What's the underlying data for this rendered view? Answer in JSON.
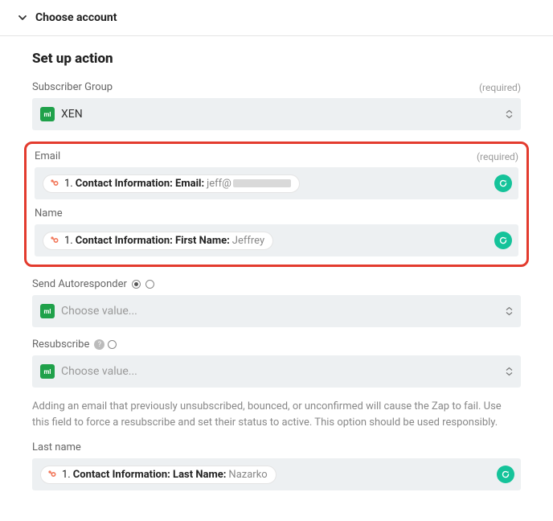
{
  "accordion": {
    "title": "Choose account"
  },
  "section_title": "Set up action",
  "labels": {
    "required": "(required)"
  },
  "fields": {
    "subscriber_group": {
      "label": "Subscriber Group",
      "value": "XEN"
    },
    "email": {
      "label": "Email",
      "step": "1.",
      "path": "Contact Information: Email:",
      "value_prefix": "jeff@"
    },
    "name": {
      "label": "Name",
      "step": "1.",
      "path": "Contact Information: First Name:",
      "value": "Jeffrey"
    },
    "autoresponder": {
      "label": "Send Autoresponder",
      "placeholder": "Choose value..."
    },
    "resubscribe": {
      "label": "Resubscribe",
      "placeholder": "Choose value...",
      "help": "Adding an email that previously unsubscribed, bounced, or unconfirmed will cause the Zap to fail. Use this field to force a resubscribe and set their status to active. This option should be used responsibly."
    },
    "lastname": {
      "label": "Last name",
      "step": "1.",
      "path": "Contact Information: Last Name:",
      "value": "Nazarko"
    }
  }
}
